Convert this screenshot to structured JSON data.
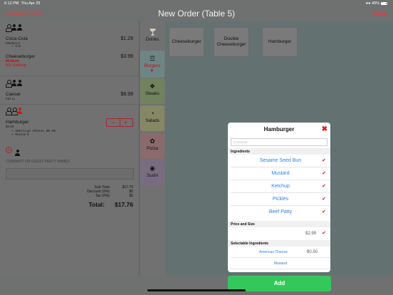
{
  "status": {
    "time": "6:12 PM",
    "date": "Thu Apr 25",
    "battery": "49%"
  },
  "nav": {
    "back": "Waiter POS",
    "title": "New Order (Table 5)",
    "save": "Save"
  },
  "order": {
    "items": [
      {
        "name": "Coca-Cola",
        "detail": "Medium  6",
        "mods": [
          "Ice"
        ],
        "price": "$1.29"
      },
      {
        "name": "Cheeseburger",
        "size": "Medium",
        "note": "NO: Ketchup",
        "price": "$3.99"
      },
      {
        "name": "Caesar",
        "detail": "Full  1x",
        "price": "$8.99"
      },
      {
        "name": "Hamburger",
        "detail": "$2.99",
        "mods": [
          "American Cheese  $0.50",
          "Mustard"
        ]
      }
    ],
    "comment_label": "COMMENT OR GUEST PARTY NAMES",
    "subtotal_label": "Sub-Total:",
    "subtotal": "$17.76",
    "discount_label": "Discount (0%):",
    "discount": "$0",
    "tax_label": "Tax (0%):",
    "tax": "$0",
    "total_label": "Total:",
    "total": "$17.76"
  },
  "categories": [
    {
      "label": "Drinks",
      "icon": "martini-icon",
      "color": "#717171"
    },
    {
      "label": "Burgers",
      "icon": "burger-icon",
      "color": "#6e8585"
    },
    {
      "label": "Steaks",
      "icon": "steak-icon",
      "color": "#70835e"
    },
    {
      "label": "Salads",
      "icon": "salad-icon",
      "color": "#868765"
    },
    {
      "label": "Pizza",
      "icon": "pizza-icon",
      "color": "#8a6a6a"
    },
    {
      "label": "Sushi",
      "icon": "sushi-icon",
      "color": "#786c81"
    }
  ],
  "menu_items": [
    "Cheeseburger",
    "Double Cheeseburger",
    "Hamburger"
  ],
  "modal": {
    "title": "Hamburger",
    "comment_placeholder": "Comment",
    "ingredients_label": "Ingredients",
    "ingredients": [
      "Sesame Seed Bun",
      "Mustard",
      "Ketchup",
      "Pickles",
      "Beef Patty"
    ],
    "price_label": "Price and Size",
    "price": "$2.99",
    "selectable_label": "Selectable Ingredients",
    "selectable": [
      {
        "name": "American Cheese",
        "price": "$0.50"
      },
      {
        "name": "Mustard"
      }
    ]
  },
  "add_label": "Add",
  "colors": {
    "accent_red": "#e23b3b",
    "add_green": "#34c85a",
    "link_blue": "#2f7fe3"
  }
}
